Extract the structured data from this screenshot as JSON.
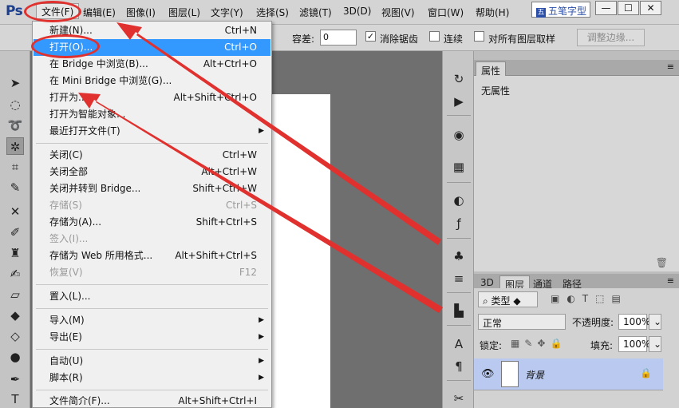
{
  "app": {
    "logo": "Ps"
  },
  "menubar": {
    "items": [
      "文件(F)",
      "编辑(E)",
      "图像(I)",
      "图层(L)",
      "文字(Y)",
      "选择(S)",
      "滤镜(T)",
      "3D(D)",
      "视图(V)",
      "窗口(W)",
      "帮助(H)"
    ],
    "ime": "五笔字型",
    "window_buttons": [
      "—",
      "☐",
      "✕"
    ]
  },
  "options": {
    "tolerance_label": "容差:",
    "tolerance_value": "0",
    "antialias_label": "消除锯齿",
    "contiguous_label": "连续",
    "sample_all_label": "对所有图层取样",
    "refine_edge_label": "调整边缘..."
  },
  "file_menu": {
    "items": [
      {
        "label": "新建(N)...",
        "shortcut": "Ctrl+N"
      },
      {
        "label": "打开(O)...",
        "shortcut": "Ctrl+O"
      },
      {
        "label": "在 Bridge 中浏览(B)...",
        "shortcut": "Alt+Ctrl+O"
      },
      {
        "label": "在 Mini Bridge 中浏览(G)...",
        "shortcut": ""
      },
      {
        "label": "打开为...",
        "shortcut": "Alt+Shift+Ctrl+O"
      },
      {
        "label": "打开为智能对象...",
        "shortcut": ""
      },
      {
        "label": "最近打开文件(T)",
        "shortcut": ""
      },
      {
        "label": "关闭(C)",
        "shortcut": "Ctrl+W"
      },
      {
        "label": "关闭全部",
        "shortcut": "Alt+Ctrl+W"
      },
      {
        "label": "关闭并转到 Bridge...",
        "shortcut": "Shift+Ctrl+W"
      },
      {
        "label": "存储(S)",
        "shortcut": "Ctrl+S"
      },
      {
        "label": "存储为(A)...",
        "shortcut": "Shift+Ctrl+S"
      },
      {
        "label": "签入(I)...",
        "shortcut": ""
      },
      {
        "label": "存储为 Web 所用格式...",
        "shortcut": "Alt+Shift+Ctrl+S"
      },
      {
        "label": "恢复(V)",
        "shortcut": "F12"
      },
      {
        "label": "置入(L)...",
        "shortcut": ""
      },
      {
        "label": "导入(M)",
        "shortcut": ""
      },
      {
        "label": "导出(E)",
        "shortcut": ""
      },
      {
        "label": "自动(U)",
        "shortcut": ""
      },
      {
        "label": "脚本(R)",
        "shortcut": ""
      },
      {
        "label": "文件简介(F)...",
        "shortcut": "Alt+Shift+Ctrl+I"
      }
    ]
  },
  "properties_panel": {
    "tab": "属性",
    "content": "无属性"
  },
  "layers_panel": {
    "tabs": [
      "3D",
      "图层",
      "通道",
      "路径"
    ],
    "filter_kind": "类型",
    "blend_mode": "正常",
    "opacity_label": "不透明度:",
    "opacity_value": "100%",
    "lock_label": "锁定:",
    "fill_label": "填充:",
    "fill_value": "100%",
    "layer_name": "背景"
  },
  "colors": {
    "highlight": "#3399ff",
    "annotation": "#e0312e"
  }
}
